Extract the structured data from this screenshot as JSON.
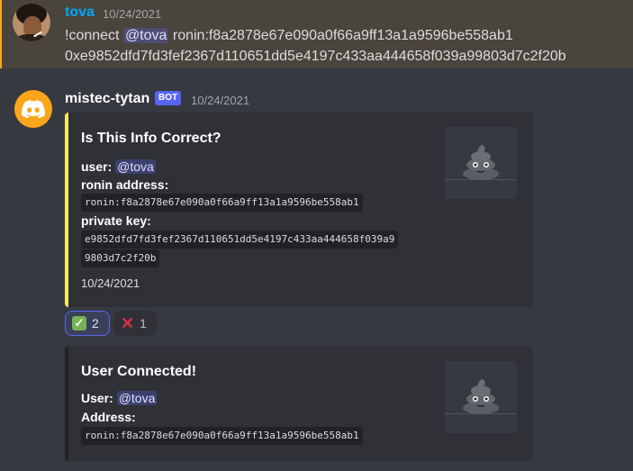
{
  "message1": {
    "username": "tova",
    "username_color": "#00a8fc",
    "timestamp": "10/24/2021",
    "command": "!connect",
    "mention": "@tova",
    "line1_rest": "ronin:f8a2878e67e090a0f66a9ff13a1a9596be558ab1",
    "line2": "0xe9852dfd7fd3fef2367d110651dd5e4197c433aa444658f039a99803d7c2f20b"
  },
  "message2": {
    "username": "mistec-tytan",
    "bot_tag": "BOT",
    "timestamp": "10/24/2021",
    "avatar_icon": "discord-logo-icon",
    "embed1": {
      "accent": "#fee75c",
      "title": "Is This Info Correct?",
      "user_label": "user:",
      "user_mention": "@tova",
      "ronin_label": "ronin address:",
      "ronin_value": "ronin:f8a2878e67e090a0f66a9ff13a1a9596be558ab1",
      "key_label": "private key:",
      "key_line1": "e9852dfd7fd3fef2367d110651dd5e4197c433aa444658f039a9",
      "key_line2": "9803d7c2f20b",
      "footer_date": "10/24/2021",
      "thumbnail_icon": "poop-icon"
    },
    "reactions": [
      {
        "emoji": "check-mark-icon",
        "count": "2"
      },
      {
        "emoji": "cross-mark-icon",
        "count": "1"
      }
    ],
    "embed2": {
      "title": "User Connected!",
      "user_label": "User:",
      "user_mention": "@tova",
      "address_label": "Address:",
      "address_value": "ronin:f8a2878e67e090a0f66a9ff13a1a9596be558ab1",
      "thumbnail_icon": "poop-icon"
    }
  }
}
